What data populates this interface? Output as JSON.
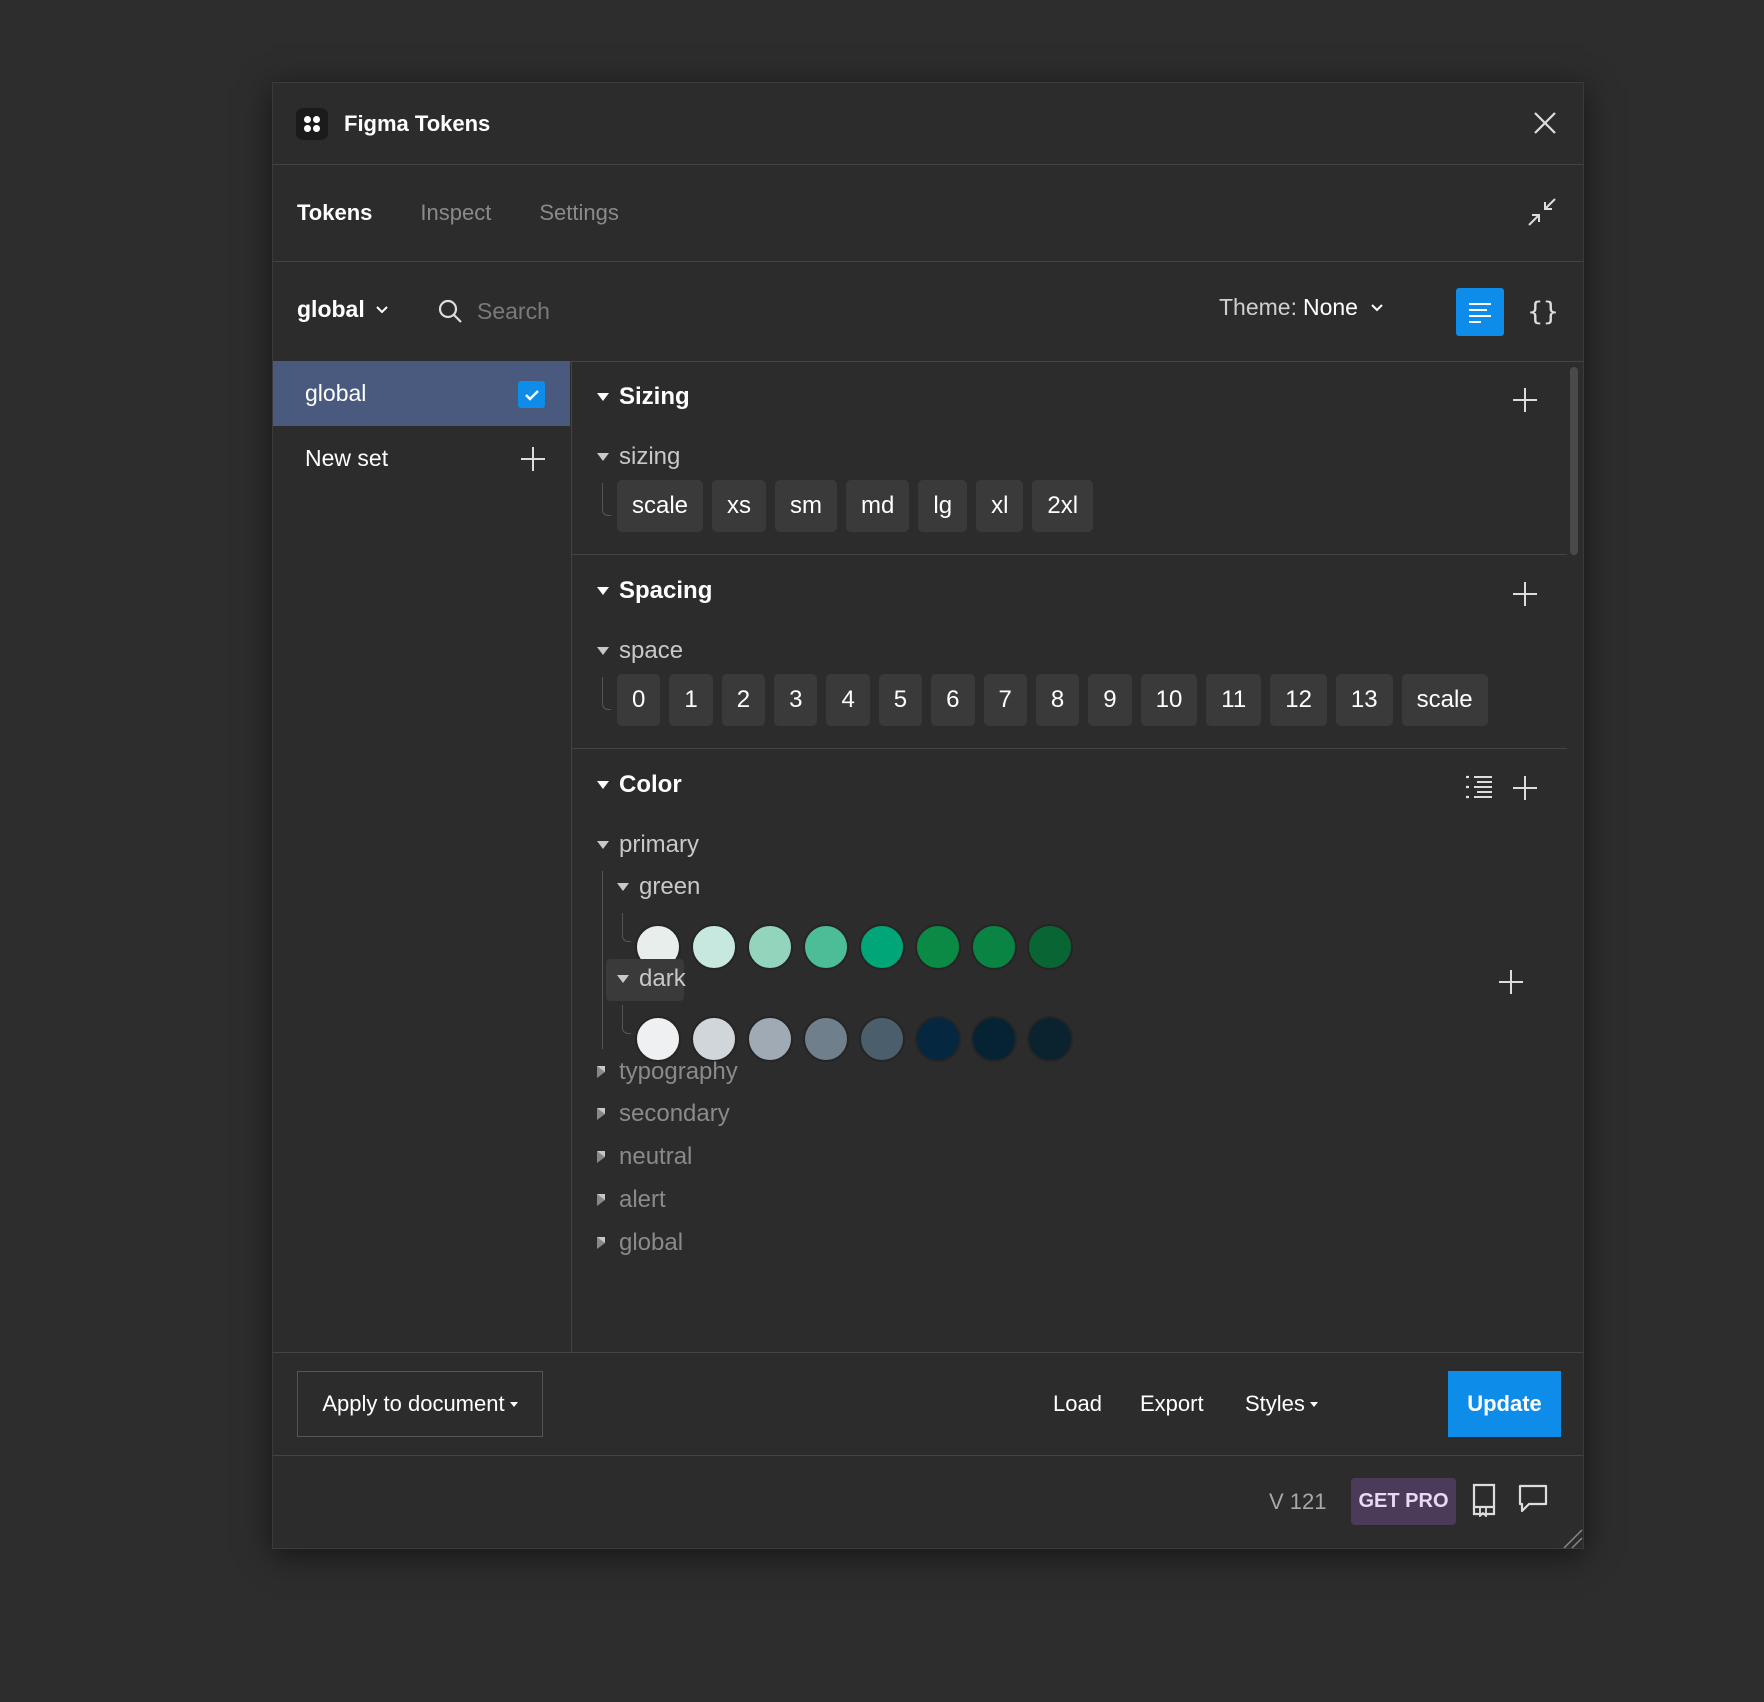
{
  "app": {
    "title": "Figma Tokens"
  },
  "tabs": [
    {
      "label": "Tokens",
      "active": true
    },
    {
      "label": "Inspect",
      "active": false
    },
    {
      "label": "Settings",
      "active": false
    }
  ],
  "toolbar": {
    "set_select": "global",
    "search_placeholder": "Search",
    "theme_label": "Theme:",
    "theme_value": "None",
    "json_icon": "{}"
  },
  "sidebar": {
    "sets": [
      {
        "label": "global",
        "checked": true
      },
      {
        "label": "New set"
      }
    ]
  },
  "sections": {
    "sizing": {
      "title": "Sizing",
      "group": "sizing",
      "tokens": [
        "scale",
        "xs",
        "sm",
        "md",
        "lg",
        "xl",
        "2xl"
      ]
    },
    "spacing": {
      "title": "Spacing",
      "group": "space",
      "tokens": [
        "0",
        "1",
        "2",
        "3",
        "4",
        "5",
        "6",
        "7",
        "8",
        "9",
        "10",
        "11",
        "12",
        "13",
        "scale"
      ]
    },
    "color": {
      "title": "Color",
      "group": "primary",
      "green": {
        "label": "green",
        "swatches": [
          "#e8eeec",
          "#c6e8de",
          "#93d4bd",
          "#4dbd97",
          "#00a578",
          "#0a8a44",
          "#0a8442",
          "#0a6535"
        ]
      },
      "dark": {
        "label": "dark",
        "swatches": [
          "#eef0f1",
          "#d1d6db",
          "#a0aab4",
          "#6f7f8c",
          "#4a5e6b",
          "#062740",
          "#062334",
          "#0b222f"
        ]
      },
      "collapsed_groups": [
        "typography",
        "secondary",
        "neutral",
        "alert",
        "global"
      ]
    }
  },
  "footer": {
    "apply": "Apply to document",
    "load": "Load",
    "export": "Export",
    "styles": "Styles",
    "update": "Update"
  },
  "status": {
    "version": "V 121",
    "pro": "GET PRO"
  },
  "colors": {
    "accent": "#0d8ce9",
    "selected_set": "#4a5a7e",
    "pro_badge": "#4b3a59"
  }
}
